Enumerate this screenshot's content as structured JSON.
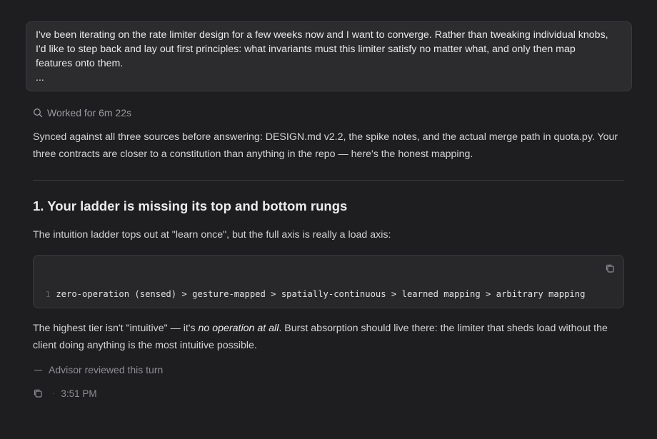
{
  "user_message": {
    "line1": "I've been iterating on the rate limiter design for a few weeks now and I want to converge. Rather than tweaking individual knobs,",
    "line2": "I'd like to step back and lay out first principles: what invariants must this limiter satisfy no matter what, and only then map",
    "line3": "features onto them.",
    "line4": "..."
  },
  "worked": {
    "icon": "search-icon",
    "label": "Worked for 6m 22s"
  },
  "intro": "Synced against all three sources before answering: DESIGN.md v2.2, the spike notes, and the actual merge path in quota.py. Your three contracts are closer to a constitution than anything in the repo — here's the honest mapping.",
  "section": {
    "heading": "1. Your ladder is missing its top and bottom rungs",
    "paragraph1": "The intuition ladder tops out at \"learn once\", but the full axis is really a load axis:",
    "code": {
      "line_number": "1",
      "text": "zero-operation (sensed) > gesture-mapped > spatially-continuous > learned mapping > arbitrary mapping",
      "copy_icon": "copy-icon"
    },
    "paragraph2_before": "The highest tier isn't \"intuitive\" — it's ",
    "paragraph2_em": "no operation at all",
    "paragraph2_after": ". Burst absorption should live there: the limiter that sheds load without the client doing anything is the most intuitive possible."
  },
  "advisor": "Advisor reviewed this turn",
  "footer": {
    "copy_icon": "copy-icon",
    "separator": "·",
    "time": "3:51 PM"
  },
  "colors": {
    "background": "#1e1e20",
    "card": "#2c2c2f",
    "code_bg": "#28282b",
    "border": "#3a3a3e",
    "text": "#d4d4d6",
    "muted": "#8e8e94"
  }
}
